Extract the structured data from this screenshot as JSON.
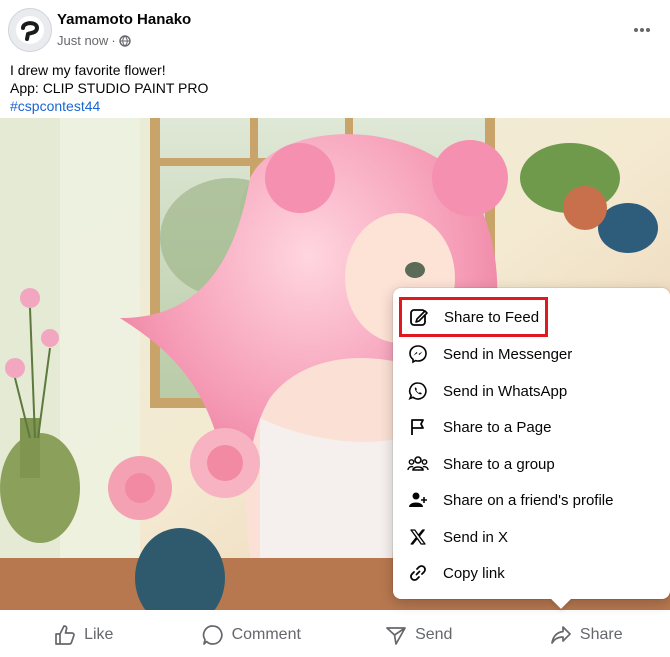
{
  "post": {
    "author": "Yamamoto Hanako",
    "timestamp": "Just now",
    "separator": "·",
    "privacy_icon": "globe-icon",
    "text_line1": "I drew my favorite flower!",
    "text_line2": "App: CLIP STUDIO PAINT PRO",
    "hashtag": "#cspcontest44",
    "more_icon": "more-dots-icon"
  },
  "share_menu": {
    "items": [
      {
        "label": "Share to Feed",
        "icon": "edit-icon"
      },
      {
        "label": "Send in Messenger",
        "icon": "messenger-icon"
      },
      {
        "label": "Send in WhatsApp",
        "icon": "whatsapp-icon"
      },
      {
        "label": "Share to a Page",
        "icon": "flag-icon"
      },
      {
        "label": "Share to a group",
        "icon": "group-icon"
      },
      {
        "label": "Share on a friend's profile",
        "icon": "friend-profile-icon"
      },
      {
        "label": "Send in X",
        "icon": "x-icon"
      },
      {
        "label": "Copy link",
        "icon": "link-icon"
      }
    ]
  },
  "actions": {
    "like": "Like",
    "comment": "Comment",
    "send": "Send",
    "share": "Share"
  },
  "colors": {
    "highlight": "#e0191f",
    "hashtag": "#1a66d2",
    "secondary_text": "#65676b"
  }
}
